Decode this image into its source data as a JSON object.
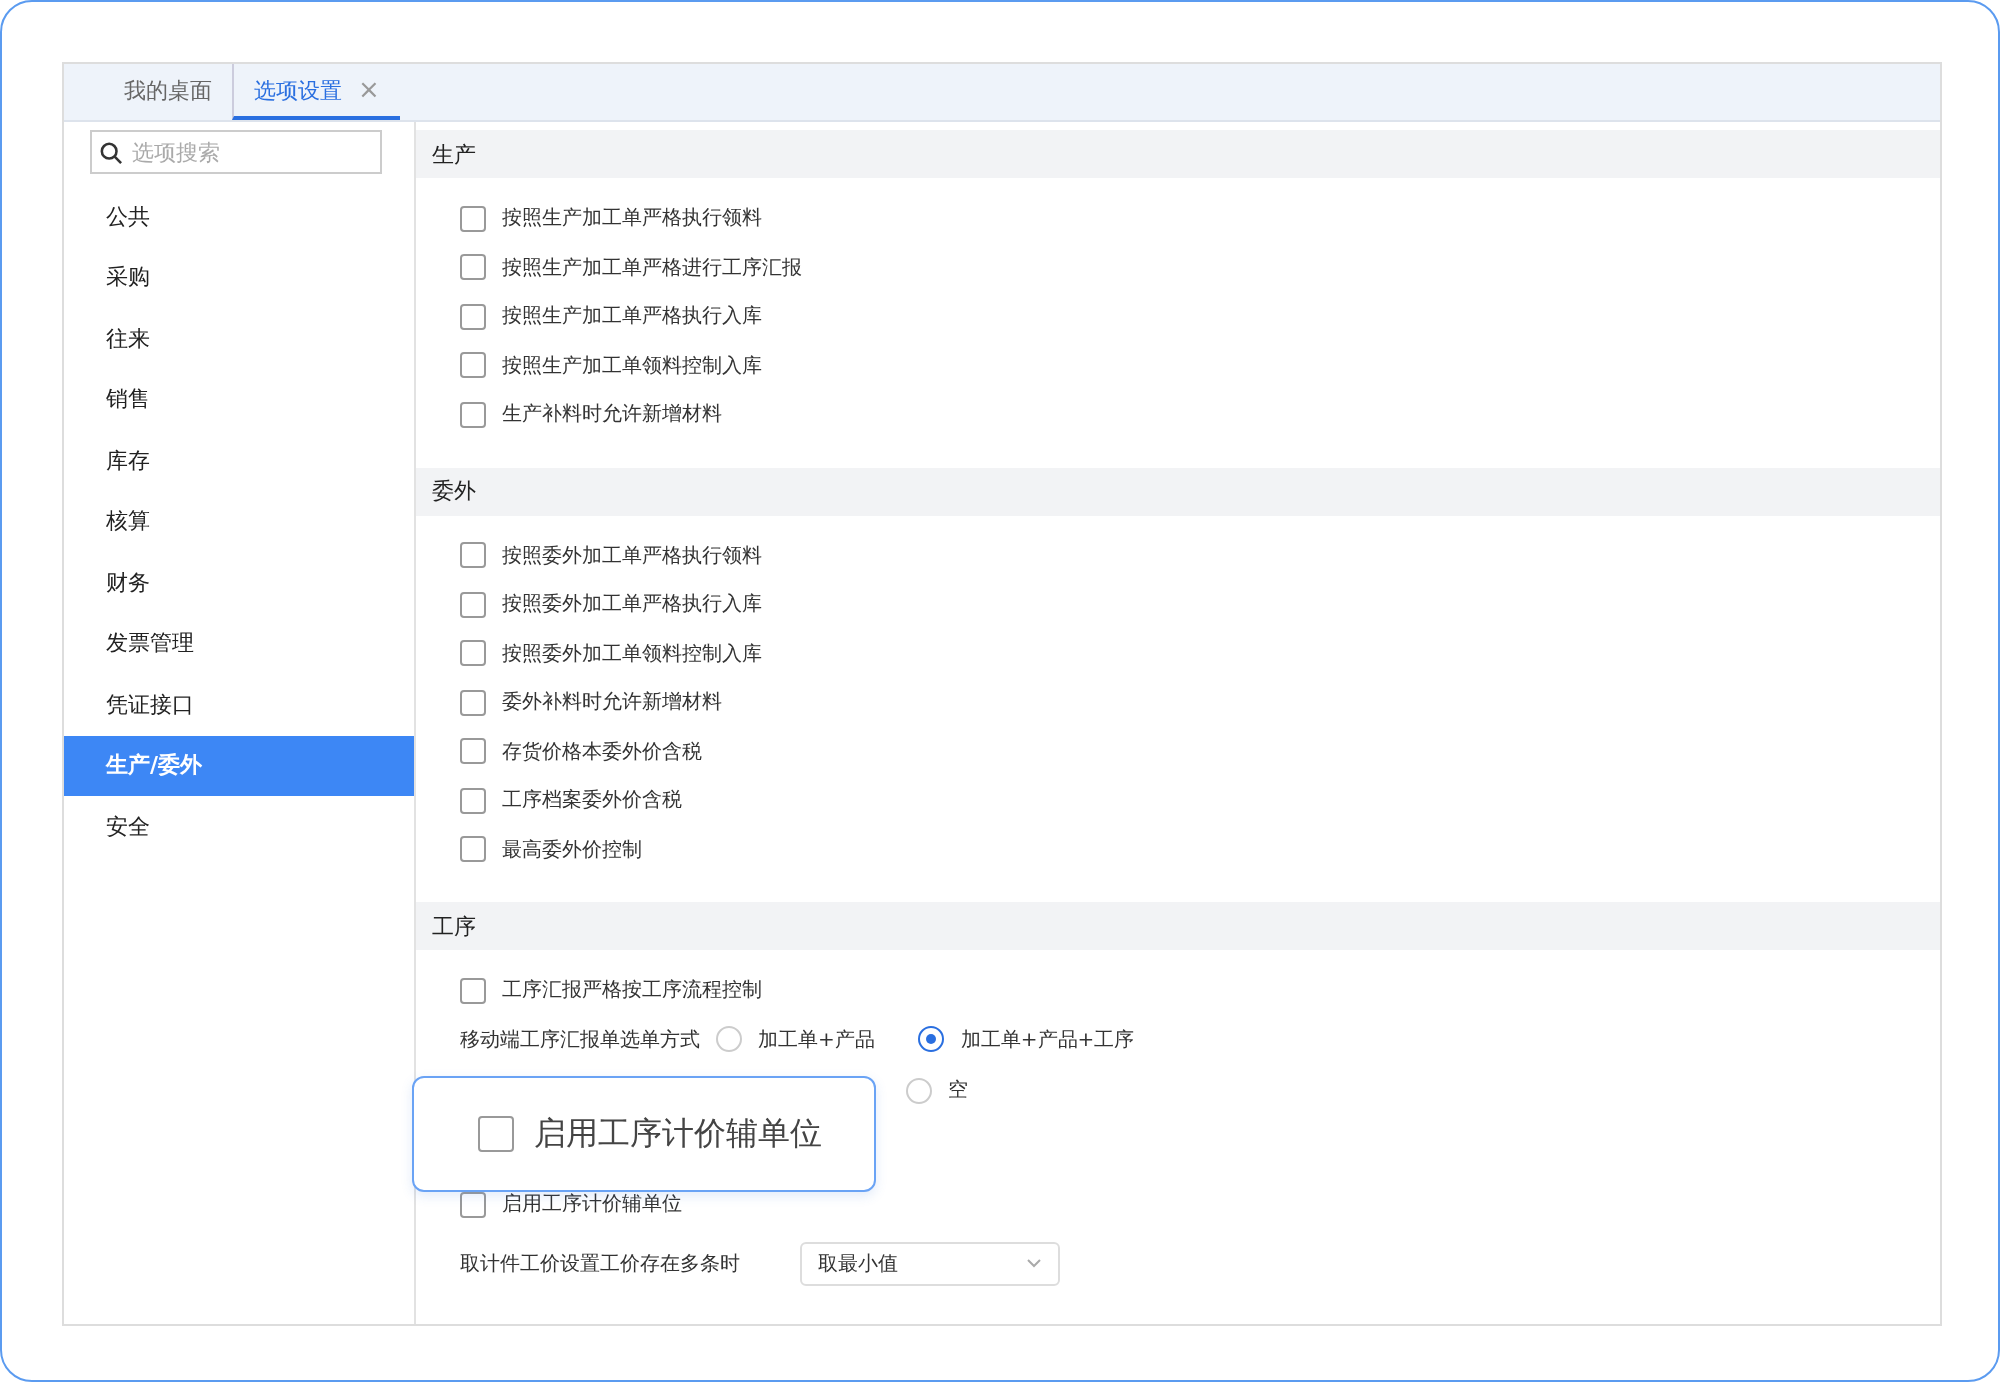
{
  "tabs": [
    {
      "label": "我的桌面",
      "selected": false
    },
    {
      "label": "选项设置",
      "selected": true,
      "close": "×"
    }
  ],
  "search": {
    "placeholder": "选项搜索"
  },
  "sidebar": {
    "items": [
      {
        "label": "公共",
        "selected": false
      },
      {
        "label": "采购",
        "selected": false
      },
      {
        "label": "往来",
        "selected": false
      },
      {
        "label": "销售",
        "selected": false
      },
      {
        "label": "库存",
        "selected": false
      },
      {
        "label": "核算",
        "selected": false
      },
      {
        "label": "财务",
        "selected": false
      },
      {
        "label": "发票管理",
        "selected": false
      },
      {
        "label": "凭证接口",
        "selected": false
      },
      {
        "label": "生产/委外",
        "selected": true
      },
      {
        "label": "安全",
        "selected": false
      }
    ]
  },
  "sections": [
    {
      "title": "生产",
      "rows": [
        {
          "kind": "checkbox",
          "label": "按照生产加工单严格执行领料",
          "checked": false
        },
        {
          "kind": "checkbox",
          "label": "按照生产加工单严格进行工序汇报",
          "checked": false
        },
        {
          "kind": "checkbox",
          "label": "按照生产加工单严格执行入库",
          "checked": false
        },
        {
          "kind": "checkbox",
          "label": "按照生产加工单领料控制入库",
          "checked": false
        },
        {
          "kind": "checkbox",
          "label": "生产补料时允许新增材料",
          "checked": false
        }
      ]
    },
    {
      "title": "委外",
      "rows": [
        {
          "kind": "checkbox",
          "label": "按照委外加工单严格执行领料",
          "checked": false
        },
        {
          "kind": "checkbox",
          "label": "按照委外加工单严格执行入库",
          "checked": false
        },
        {
          "kind": "checkbox",
          "label": "按照委外加工单领料控制入库",
          "checked": false
        },
        {
          "kind": "checkbox",
          "label": "委外补料时允许新增材料",
          "checked": false
        },
        {
          "kind": "checkbox",
          "label": "存货价格本委外价含税",
          "checked": false
        },
        {
          "kind": "checkbox",
          "label": "工序档案委外价含税",
          "checked": false
        },
        {
          "kind": "checkbox",
          "label": "最高委外价控制",
          "checked": false
        }
      ]
    },
    {
      "title": "工序",
      "rows": [
        {
          "kind": "checkbox",
          "label": "工序汇报严格按工序流程控制",
          "checked": false
        },
        {
          "kind": "radio",
          "label": "移动端工序汇报单选单方式",
          "options": [
            {
              "label": "加工单+产品",
              "selected": false
            },
            {
              "label": "加工单+产品+工序",
              "selected": true
            }
          ]
        },
        {
          "kind": "radio",
          "options": [
            {
              "label": "空",
              "selected": false
            }
          ]
        },
        {
          "kind": "checkbox",
          "label": "启用工序计价辅单位",
          "checked": false
        },
        {
          "kind": "select",
          "label": "取计件工价设置工价存在多条时",
          "value": "取最小值"
        }
      ]
    }
  ],
  "callout": {
    "label": "启用工序计价辅单位",
    "checked": false
  }
}
